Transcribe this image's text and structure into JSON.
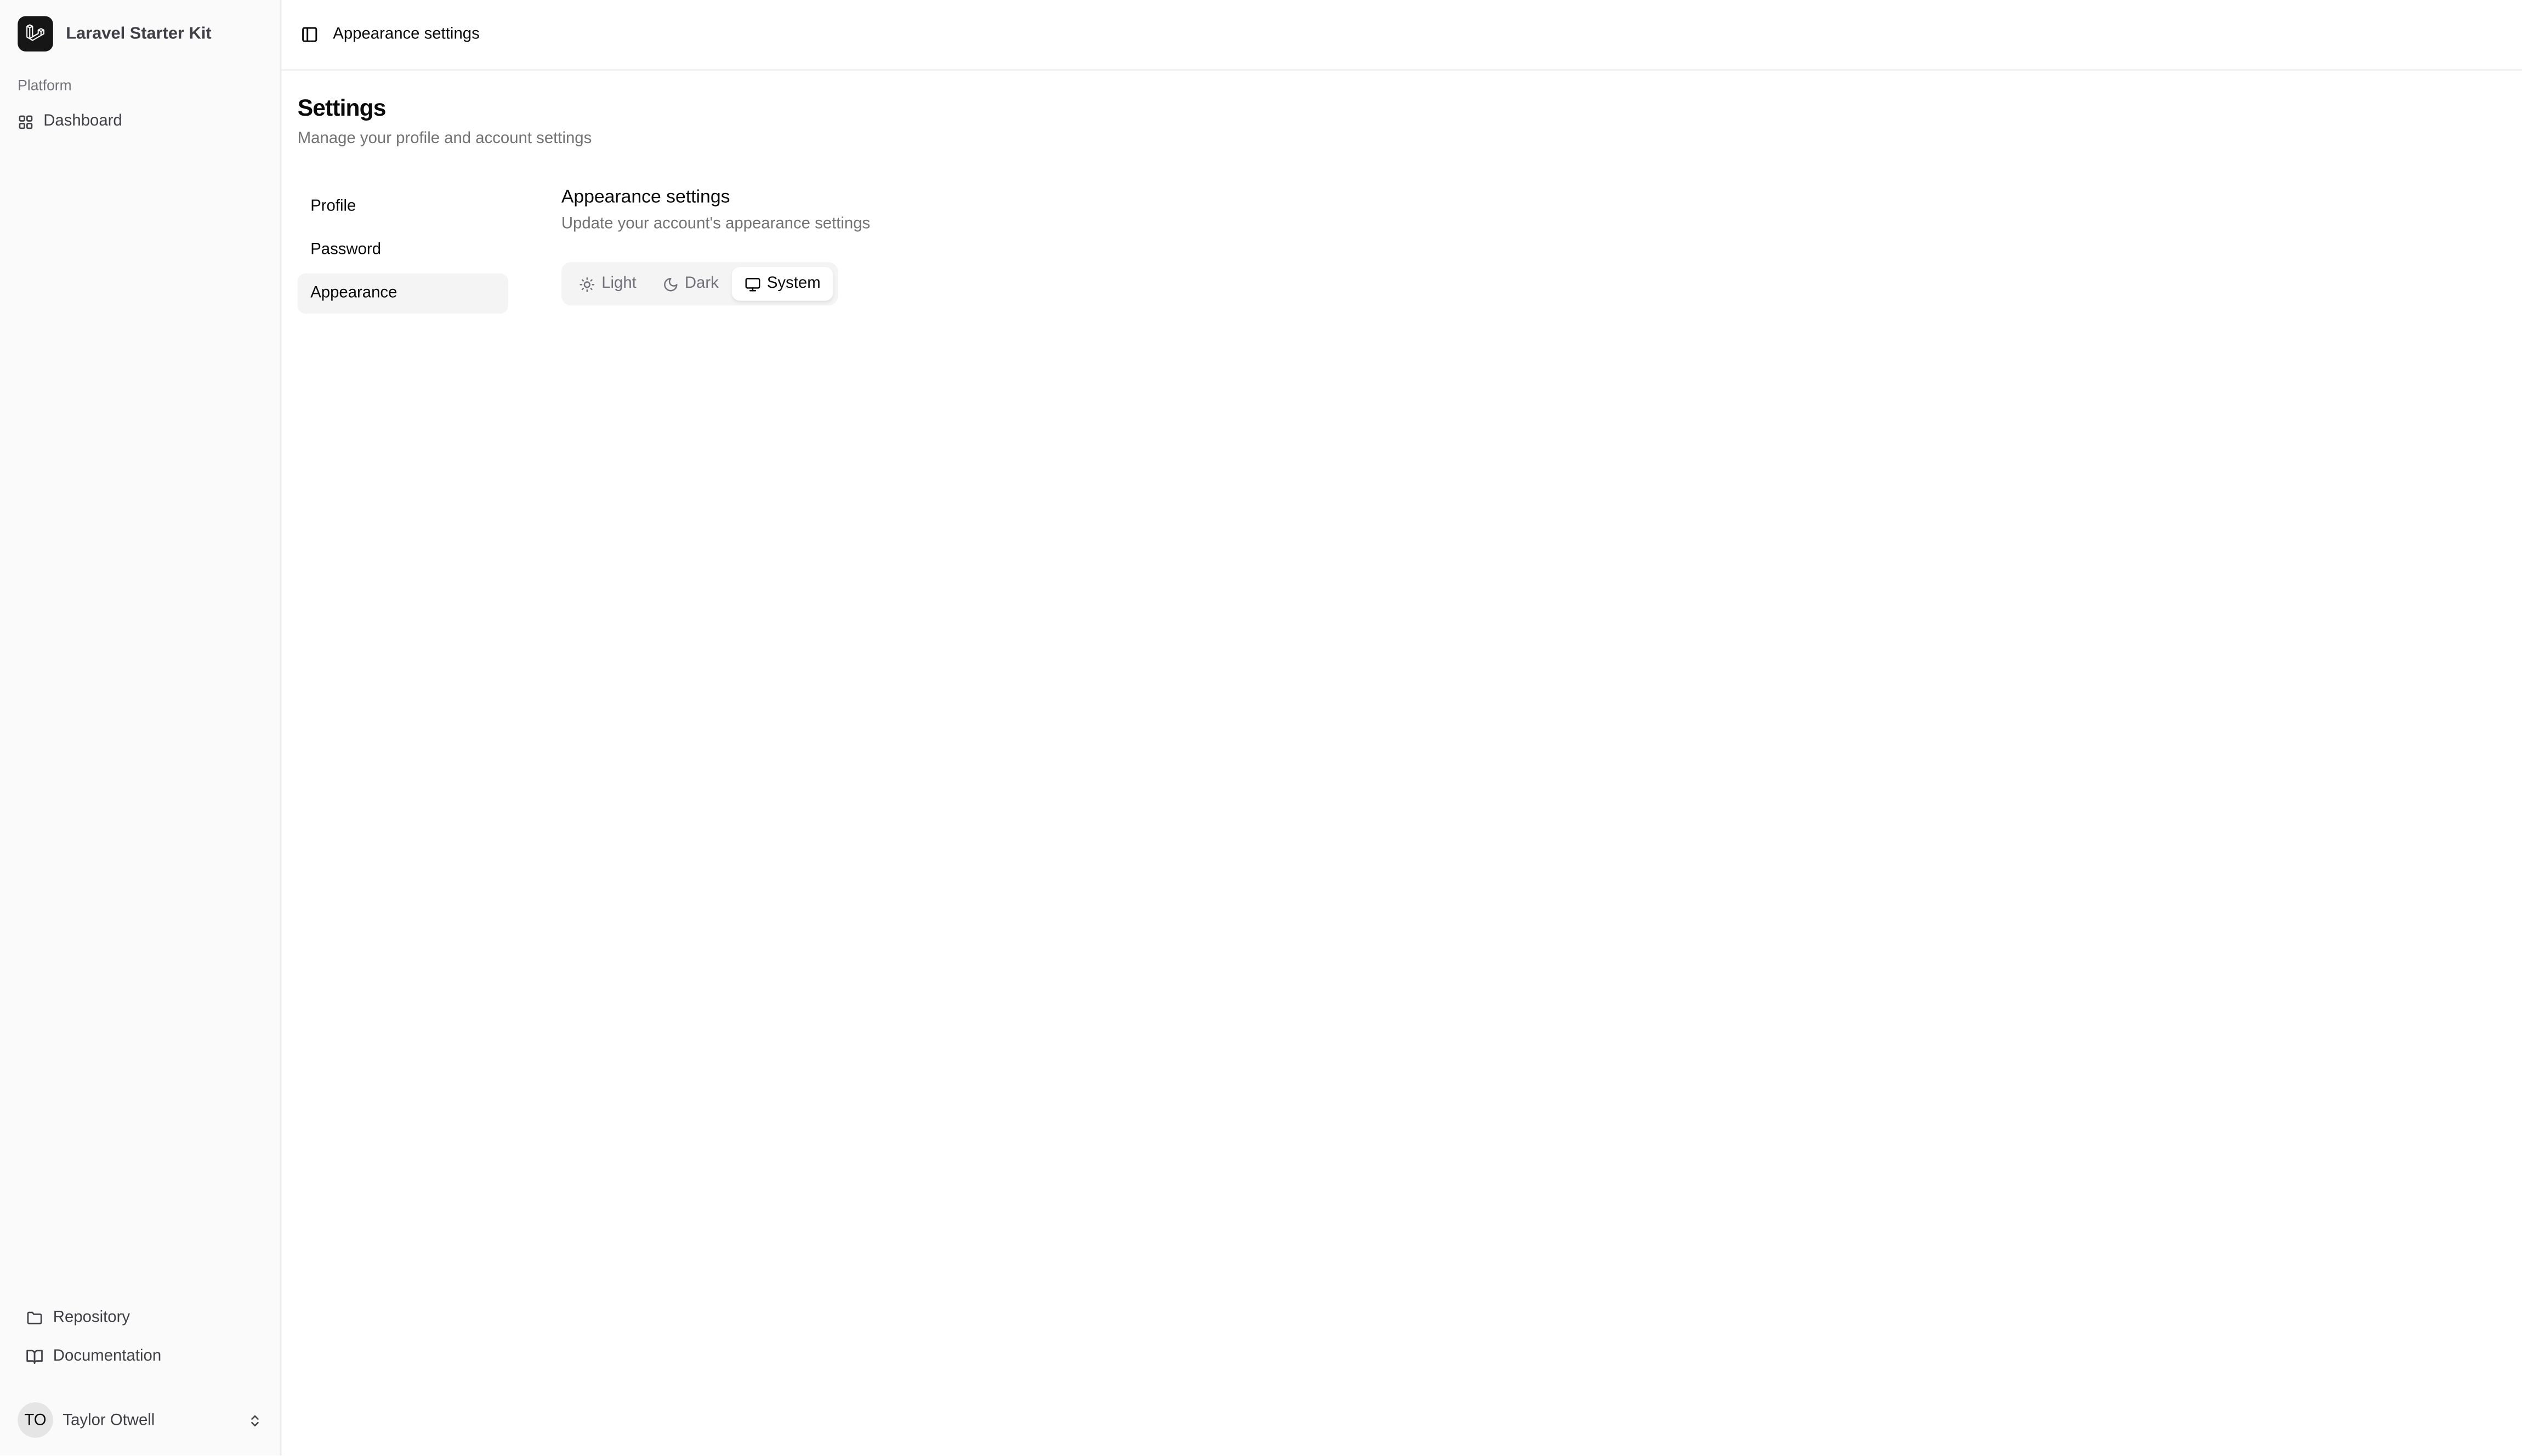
{
  "app": {
    "name": "Laravel Starter Kit"
  },
  "sidebar": {
    "group_label": "Platform",
    "main_items": [
      {
        "label": "Dashboard",
        "icon": "layout-grid-icon"
      }
    ],
    "footer_items": [
      {
        "label": "Repository",
        "icon": "folder-icon"
      },
      {
        "label": "Documentation",
        "icon": "book-open-icon"
      }
    ],
    "user": {
      "initials": "TO",
      "name": "Taylor Otwell"
    }
  },
  "header": {
    "breadcrumb": "Appearance settings"
  },
  "page": {
    "title": "Settings",
    "subtitle": "Manage your profile and account settings"
  },
  "settings_nav": [
    {
      "label": "Profile",
      "active": false
    },
    {
      "label": "Password",
      "active": false
    },
    {
      "label": "Appearance",
      "active": true
    }
  ],
  "section": {
    "title": "Appearance settings",
    "subtitle": "Update your account's appearance settings",
    "options": [
      {
        "label": "Light",
        "icon": "sun-icon",
        "selected": false
      },
      {
        "label": "Dark",
        "icon": "moon-icon",
        "selected": false
      },
      {
        "label": "System",
        "icon": "monitor-icon",
        "selected": true
      }
    ]
  },
  "colors": {
    "sidebar_bg": "#fafafa",
    "active_bg": "#f4f4f5",
    "muted_text": "#737373",
    "logo_bg": "#161616"
  }
}
